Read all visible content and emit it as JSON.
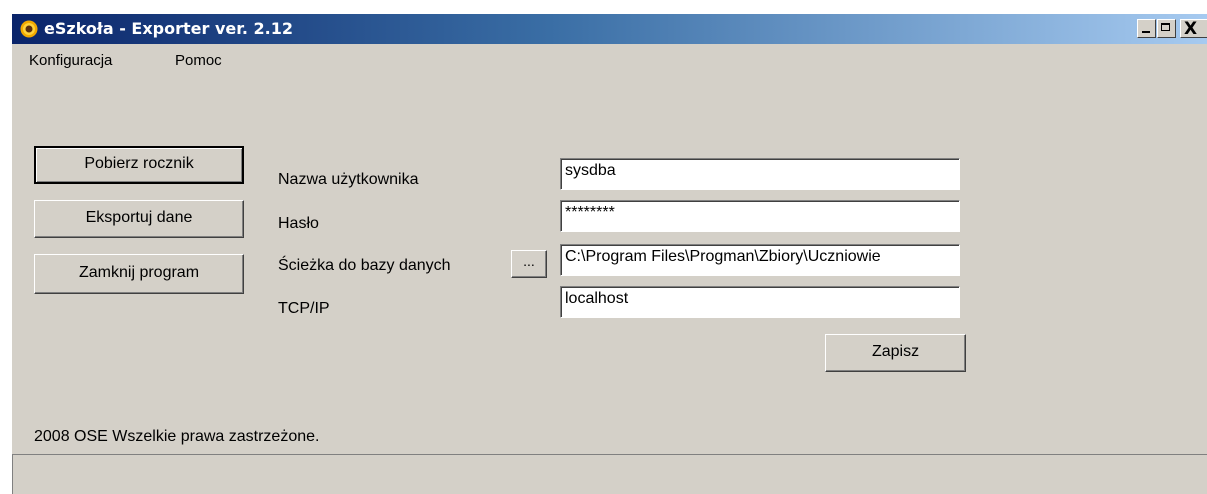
{
  "window": {
    "title": "eSzkoła - Exporter ver. 2.12",
    "controls": {
      "minimize": "_",
      "maximize": "□",
      "close": "X"
    }
  },
  "menu": {
    "items": [
      {
        "label": "Konfiguracja"
      },
      {
        "label": "Pomoc"
      }
    ]
  },
  "actions": {
    "fetch_year": "Pobierz rocznik",
    "export_data": "Eksportuj dane",
    "close_program": "Zamknij program"
  },
  "form": {
    "username_label": "Nazwa użytkownika",
    "username_value": "sysdba",
    "password_label": "Hasło",
    "password_value": "********",
    "db_path_label": "Ścieżka do bazy danych",
    "browse_label": "...",
    "db_path_value": "C:\\Program Files\\Progman\\Zbiory\\Uczniowie",
    "tcpip_label": "TCP/IP",
    "tcpip_value": "localhost",
    "save_label": "Zapisz"
  },
  "footer": {
    "copyright": "2008 OSE Wszelkie prawa zastrzeżone."
  },
  "icons": {
    "app": "sunflower-icon"
  },
  "colors": {
    "titlebar_start": "#0a246a",
    "titlebar_end": "#a6caf0",
    "window_bg": "#d4d0c8"
  }
}
